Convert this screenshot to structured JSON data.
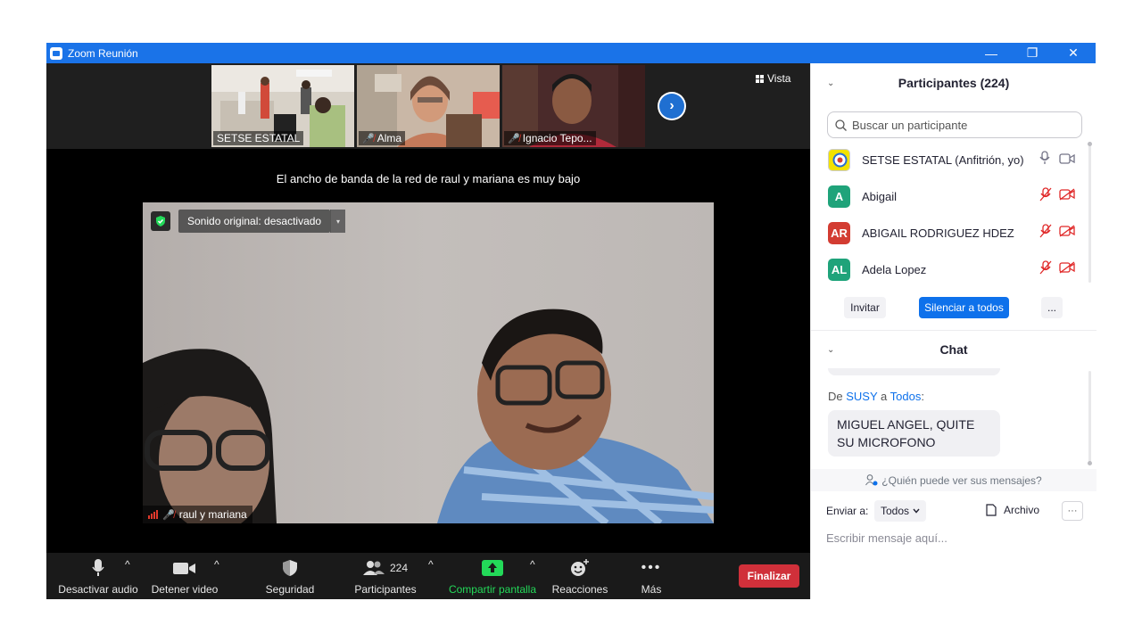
{
  "window": {
    "title": "Zoom Reunión",
    "minimize": "—",
    "maximize": "❐",
    "close": "✕"
  },
  "strip": {
    "thumbnails": [
      {
        "name": "SETSE ESTATAL",
        "muted": false
      },
      {
        "name": "Alma",
        "muted": true
      },
      {
        "name": "Ignacio Tepo...",
        "muted": true
      }
    ],
    "view_label": "Vista",
    "next_arrow": "›"
  },
  "bandwidth_message": "El ancho de banda de la red de raul y mariana es muy bajo",
  "main_video": {
    "sound_label": "Sonido original: desactivado",
    "caret": "▾",
    "name": "raul y mariana"
  },
  "toolbar": {
    "audio": "Desactivar audio",
    "video": "Detener video",
    "security": "Seguridad",
    "participants": "Participantes",
    "participants_count": "224",
    "share": "Compartir pantalla",
    "reactions": "Reacciones",
    "more": "Más",
    "caret": "^",
    "end": "Finalizar"
  },
  "participants_panel": {
    "title": "Participantes (224)",
    "collapse": "⌄",
    "search_placeholder": "Buscar un participante",
    "list": [
      {
        "initials": "",
        "name": "SETSE ESTATAL (Anfitrión, yo)",
        "color": "#f2e200",
        "muted": false
      },
      {
        "initials": "A",
        "name": "Abigail",
        "color": "#1fa37a",
        "muted": true
      },
      {
        "initials": "AR",
        "name": "ABIGAIL RODRIGUEZ HDEZ",
        "color": "#d33c32",
        "muted": true
      },
      {
        "initials": "AL",
        "name": "Adela Lopez",
        "color": "#1fa37a",
        "muted": true
      }
    ],
    "invite": "Invitar",
    "mute_all": "Silenciar a todos",
    "more": "..."
  },
  "chat": {
    "title": "Chat",
    "from_prefix": "De",
    "from_name": "SUSY",
    "to_word": "a",
    "to_name": "Todos",
    "to_suffix": ":",
    "message": "MIGUEL ANGEL, QUITE SU MICROFONO",
    "who_sees": "¿Quién puede ver sus mensajes?",
    "send_to_label": "Enviar a:",
    "send_to_value": "Todos",
    "file_label": "Archivo",
    "more": "···",
    "input_placeholder": "Escribir mensaje aquí..."
  },
  "colors": {
    "titlebar": "#1a73e8",
    "primary": "#0e71eb",
    "end_button": "#d0303a",
    "share_green": "#23d959"
  }
}
